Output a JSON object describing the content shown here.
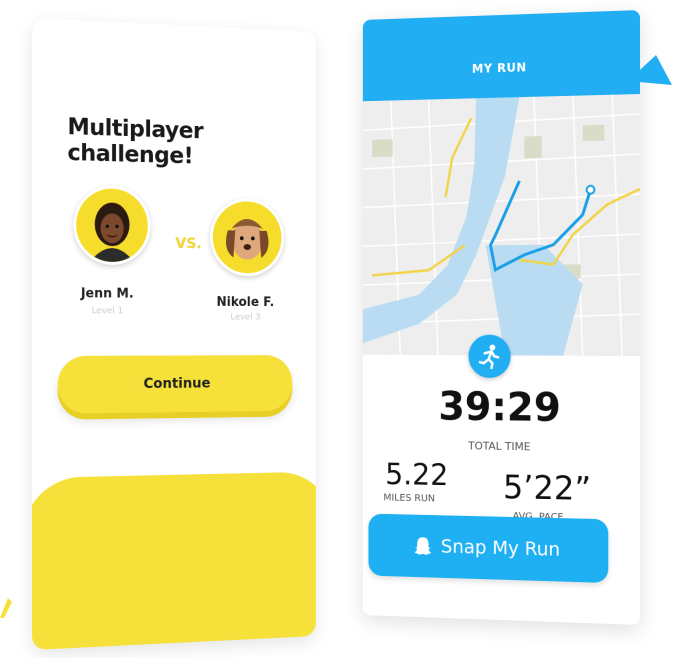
{
  "left_card": {
    "title": "Multiplayer challenge!",
    "vs_label": "VS.",
    "players": [
      {
        "name": "Jenn M.",
        "level": "Level 1"
      },
      {
        "name": "Nikole F.",
        "level": "Level 3"
      }
    ],
    "continue_label": "Continue"
  },
  "right_card": {
    "header_title": "MY RUN",
    "total_time": "39:29",
    "total_time_label": "TOTAL TIME",
    "miles": "5.22",
    "miles_label": "MILES RUN",
    "pace": "5’22”",
    "pace_label": "AVG. PACE",
    "snap_label": "Snap My Run"
  },
  "colors": {
    "brand_yellow": "#f6e03a",
    "brand_blue": "#22aef2"
  },
  "icons": [
    "runner-icon",
    "ghost-icon"
  ]
}
